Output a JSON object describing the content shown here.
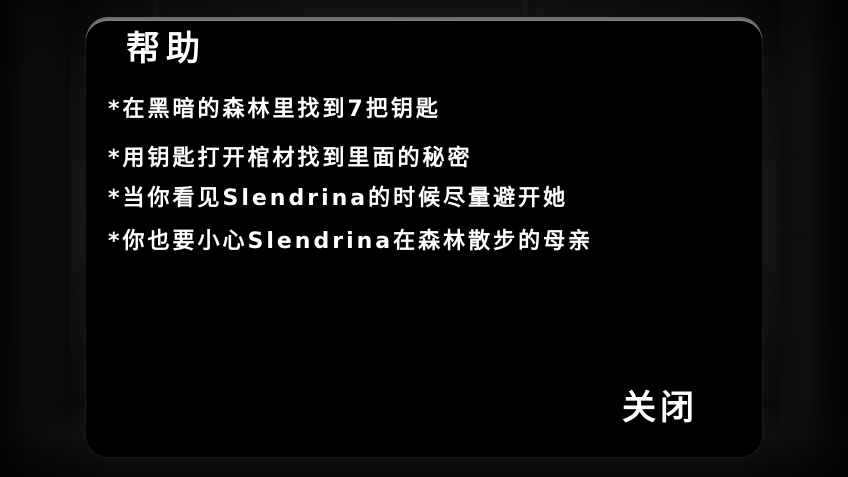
{
  "dialog": {
    "title": "帮助",
    "lines": [
      "*在黑暗的森林里找到7把钥匙",
      "*用钥匙打开棺材找到里面的秘密",
      "*当你看见Slendrina的时候尽量避开她",
      "*你也要小心Slendrina在森林散步的母亲"
    ],
    "close_label": "关闭"
  },
  "colors": {
    "panel_background": "#000000",
    "text": "#ffffff",
    "scene_background": "#232323"
  }
}
